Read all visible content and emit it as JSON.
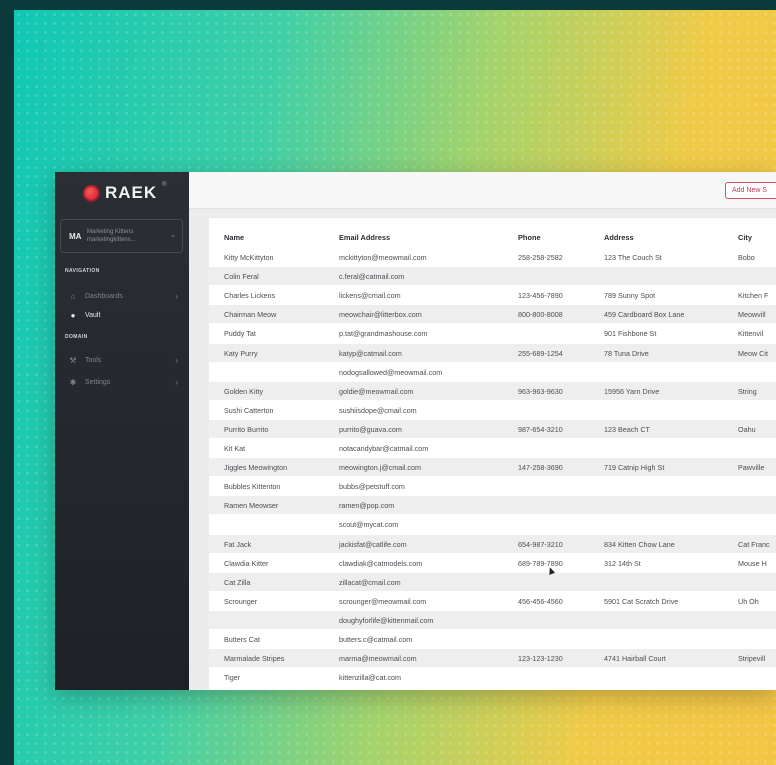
{
  "brand": {
    "name": "RAEK",
    "tm": "®"
  },
  "workspace": {
    "initials": "MA",
    "name": "Marketing Kittens",
    "subtitle": "marketingkittens..."
  },
  "sections": {
    "navigation": "NAVIGATION",
    "domain": "DOMAIN"
  },
  "nav": [
    {
      "label": "Dashboards",
      "icon": "home-icon",
      "glyph": "⌂",
      "has_chevron": true,
      "active": false
    },
    {
      "label": "Vault",
      "icon": "vault-icon",
      "glyph": "●",
      "has_chevron": false,
      "active": true
    },
    {
      "label": "Tools",
      "icon": "tools-icon",
      "glyph": "⚒",
      "has_chevron": true,
      "active": false
    },
    {
      "label": "Settings",
      "icon": "gear-icon",
      "glyph": "✱",
      "has_chevron": true,
      "active": false
    }
  ],
  "toolbar": {
    "add_button_label": "Add New S"
  },
  "table": {
    "columns": [
      "Name",
      "Email Address",
      "Phone",
      "Address",
      "City"
    ],
    "rows": [
      [
        "Kitty McKittyton",
        "mckittyton@meowmail.com",
        "258-258-2582",
        "123 The Couch St",
        "Bobo"
      ],
      [
        "Colin Feral",
        "c.feral@catmail.com",
        "",
        "",
        ""
      ],
      [
        "Charles Lickens",
        "lickens@cmail.com",
        "123-456-7890",
        "789 Sunny Spot",
        "Kitchen F"
      ],
      [
        "Chairman Meow",
        "meowchair@litterbox.com",
        "800-800-8008",
        "459 Cardboard Box Lane",
        "Meowvill"
      ],
      [
        "Puddy Tat",
        "p.tat@grandmashouse.com",
        "",
        "901 Fishbone St",
        "Kittenvil"
      ],
      [
        "Katy Purry",
        "katyp@catmail.com",
        "255-689-1254",
        "78 Tuna Drive",
        "Meow Cit"
      ],
      [
        "",
        "nodogsallowed@meowmail.com",
        "",
        "",
        ""
      ],
      [
        "Golden Kitty",
        "goldie@meowmail.com",
        "963-963-9630",
        "15956 Yarn Drive",
        "String"
      ],
      [
        "Sushi Catterton",
        "sushiisdope@cmail.com",
        "",
        "",
        ""
      ],
      [
        "Purrito Burrito",
        "purrito@guava.com",
        "987-654-3210",
        "123 Beach CT",
        "Oahu"
      ],
      [
        "Kit Kat",
        "notacandybar@catmail.com",
        "",
        "",
        ""
      ],
      [
        "Jiggles Meowington",
        "meowington.j@cmail.com",
        "147-258-3690",
        "719 Catnip High St",
        "Pawville"
      ],
      [
        "Bubbles Kittenton",
        "bubbs@petstuff.com",
        "",
        "",
        ""
      ],
      [
        "Ramen Meowser",
        "ramen@pop.com",
        "",
        "",
        ""
      ],
      [
        "",
        "scout@mycat.com",
        "",
        "",
        ""
      ],
      [
        "Fat Jack",
        "jackisfat@catlife.com",
        "654-987-3210",
        "834 Kitten Chow Lane",
        "Cat Franc"
      ],
      [
        "Clawdia Kitter",
        "clawdiak@catmodels.com",
        "689-789-7890",
        "312 14th St",
        "Mouse H"
      ],
      [
        "Cat Zilla",
        "zillacat@cmail.com",
        "",
        "",
        ""
      ],
      [
        "Scrounger",
        "scrounger@meowmail.com",
        "456-456-4560",
        "5901 Cat Scratch Drive",
        "Uh Oh"
      ],
      [
        "",
        "doughyforlife@kittenmail.com",
        "",
        "",
        ""
      ],
      [
        "Butters Cat",
        "butters.c@catmail.com",
        "",
        "",
        ""
      ],
      [
        "Marmalade Stripes",
        "marma@meowmail.com",
        "123-123-1230",
        "4741 Hairball Court",
        "Stripevill"
      ],
      [
        "Tiger",
        "kittenzilla@cat.com",
        "",
        "",
        ""
      ]
    ]
  }
}
